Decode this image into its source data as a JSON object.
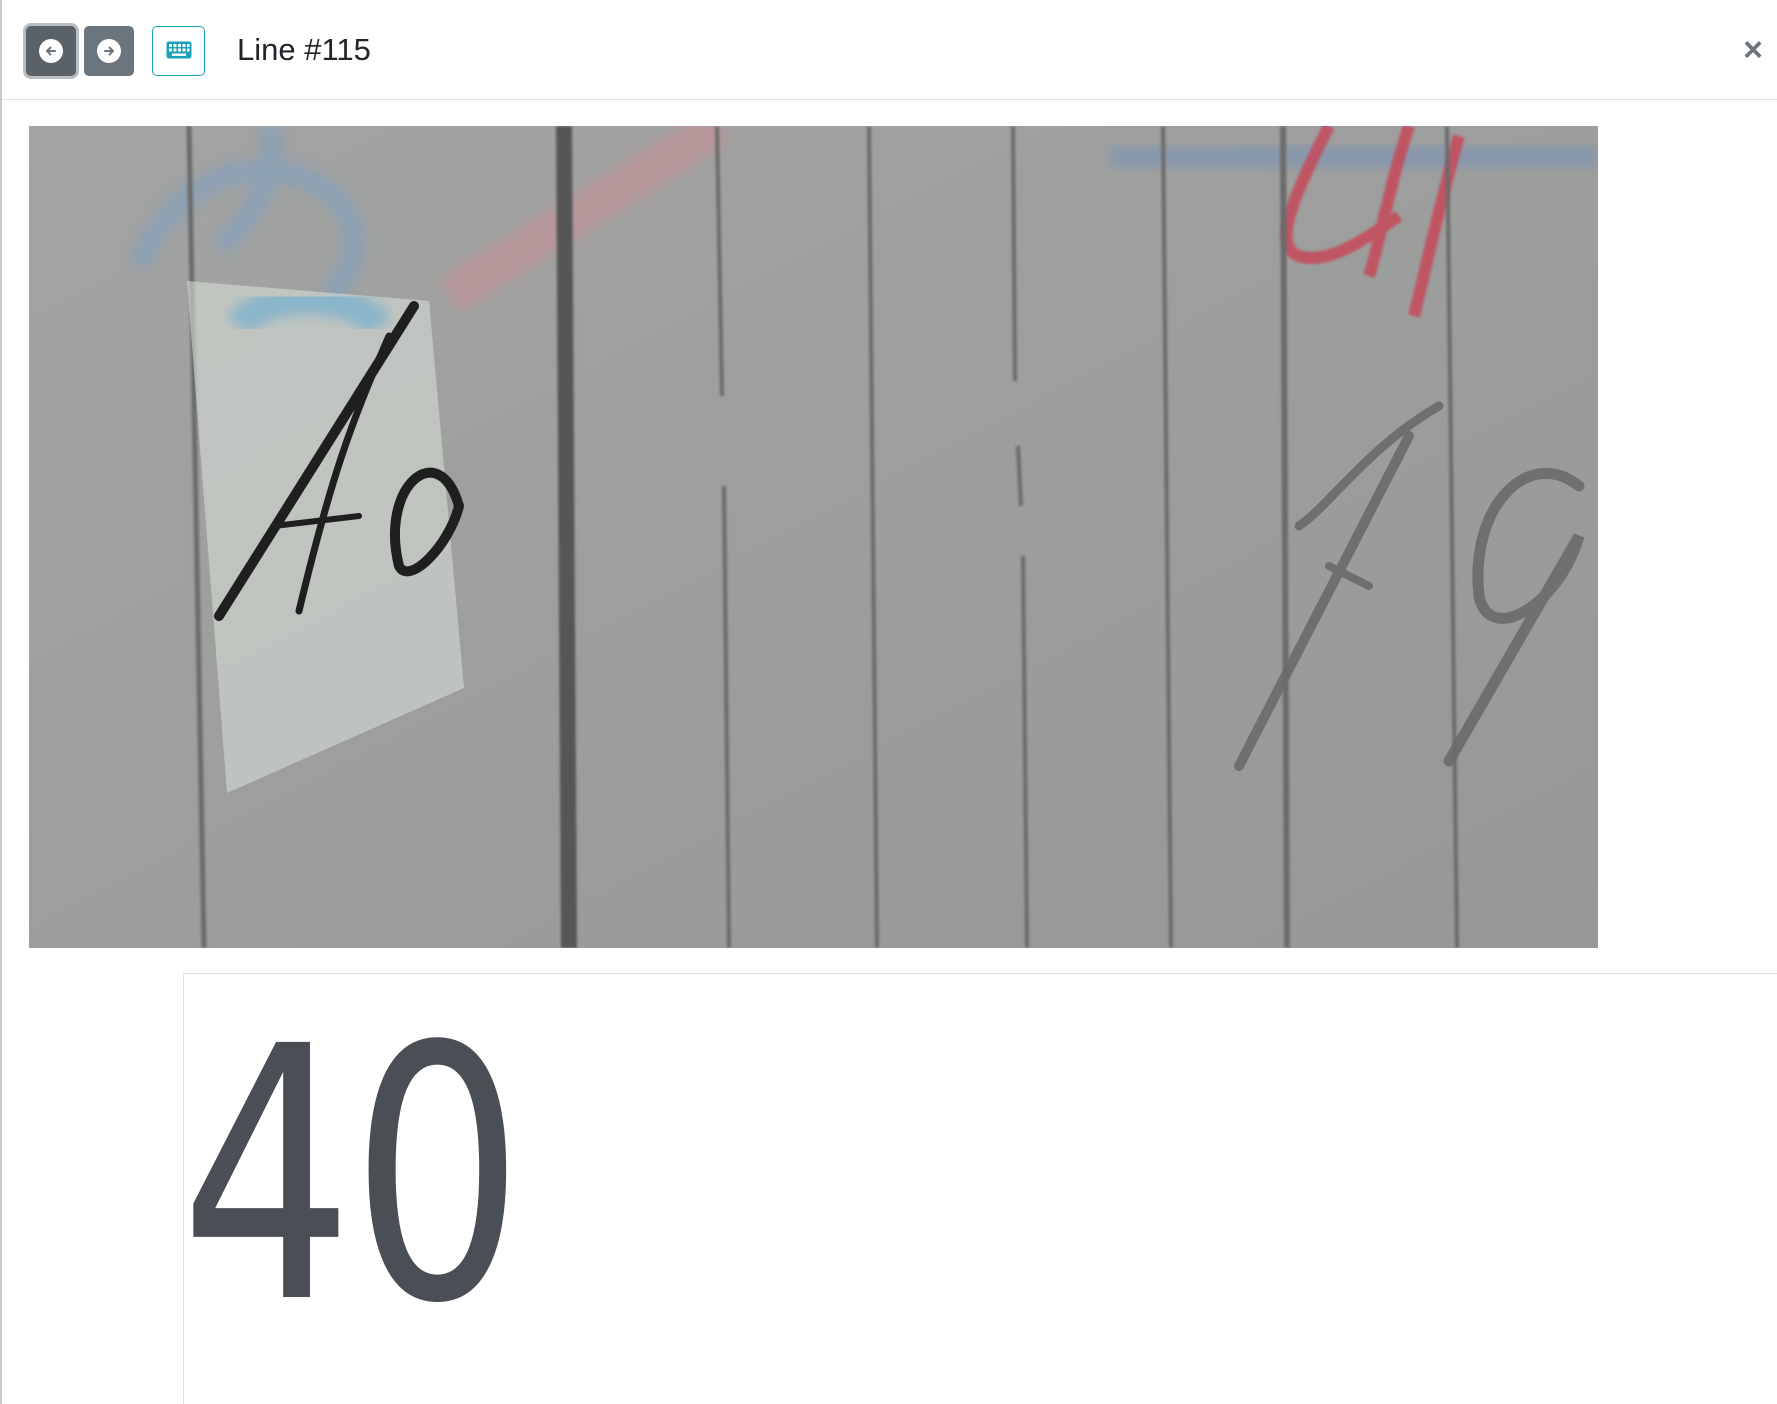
{
  "modal": {
    "title": "Line #115",
    "close_label": "×"
  },
  "toolbar": {
    "prev_icon": "arrow-left-circle-icon",
    "next_icon": "arrow-right-circle-icon",
    "keyboard_icon": "keyboard-icon",
    "accent_color": "#17a2b8",
    "button_color": "#6c757d"
  },
  "line_image": {
    "handwritten_text": "40",
    "handwritten_text_right": "79"
  },
  "transcription": {
    "value": "40"
  }
}
